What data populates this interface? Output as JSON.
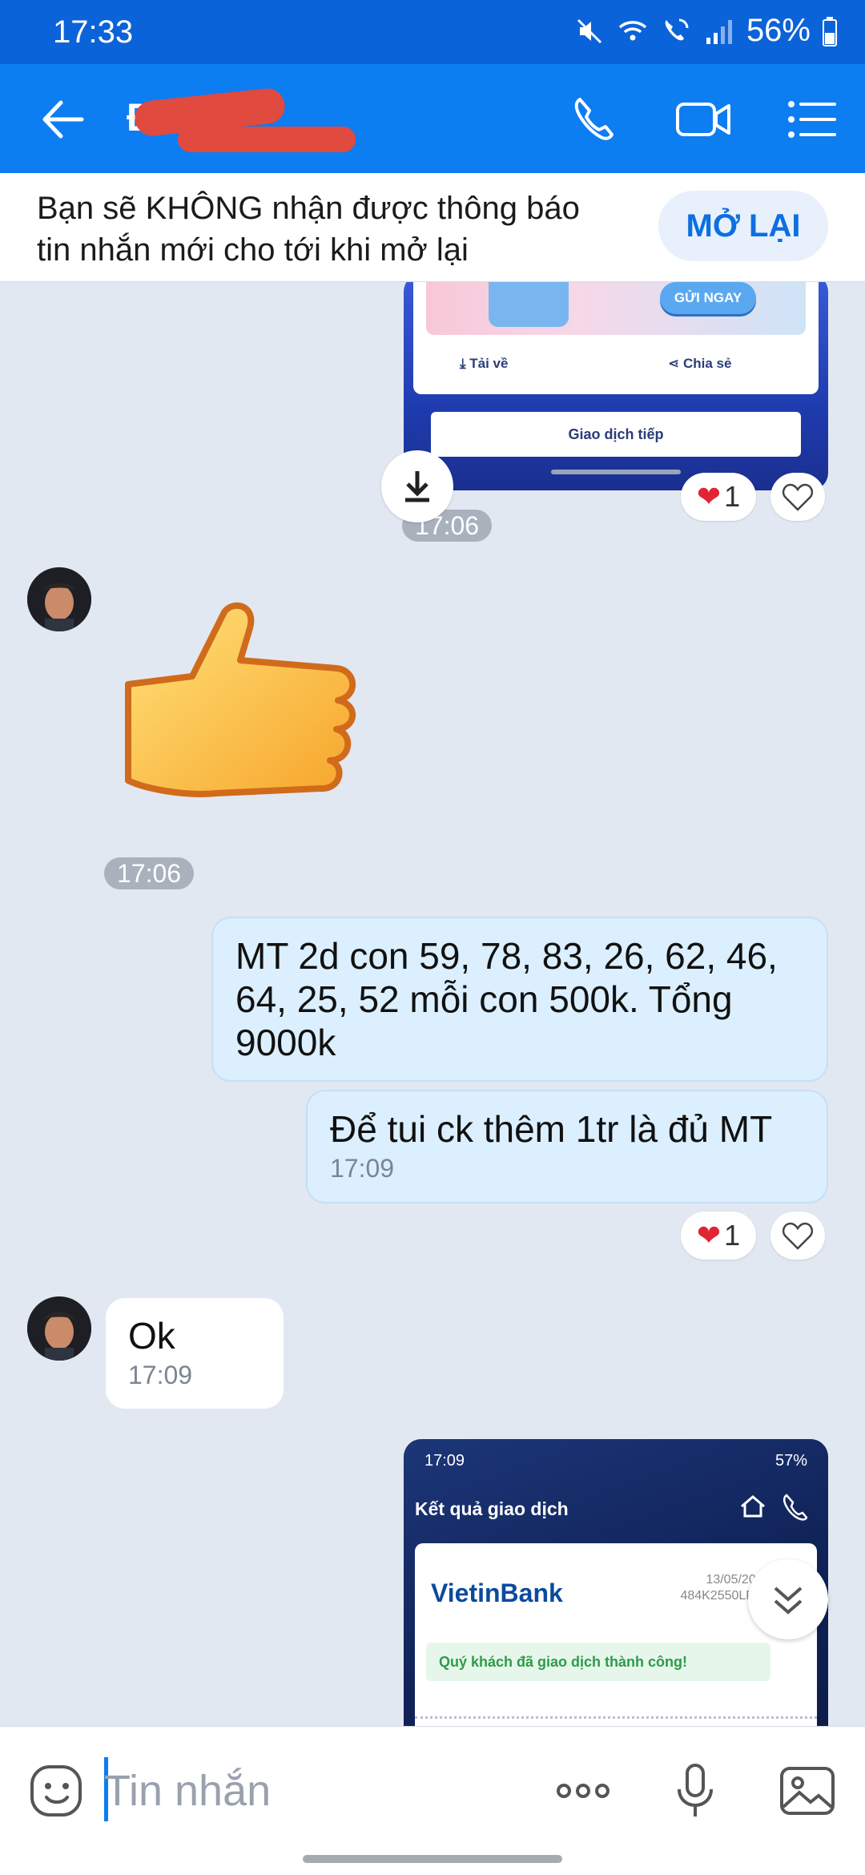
{
  "status_bar": {
    "time": "17:33",
    "battery": "56%"
  },
  "header": {
    "contact_name": "Đ"
  },
  "notice": {
    "text_line1": "Bạn sẽ KHÔNG nhận được thông báo",
    "text_line2": "tin nhắn mới cho tới khi mở lại",
    "button": "MỞ LẠI"
  },
  "promo_card": {
    "send_now": "GỬI NGAY",
    "download": "Tải về",
    "share": "Chia sẻ",
    "continue": "Giao dịch tiếp",
    "reaction_count": "1"
  },
  "messages": {
    "time_1": "17:06",
    "time_2": "17:06",
    "out_1": "MT 2d con 59, 78, 83, 26, 62, 46, 64, 25, 52 mỗi con 500k. Tổng 9000k",
    "out_2": "Để tui ck thêm 1tr là đủ MT",
    "out_2_time": "17:09",
    "out_2_reaction_count": "1",
    "in_1": "Ok",
    "in_1_time": "17:09"
  },
  "receipt_card": {
    "status_time": "17:09",
    "status_battery": "57%",
    "title": "Kết quả giao dịch",
    "bank": "VietinBank",
    "date": "13/05/2025 17:09",
    "ref": "484K2550LEUK4KVN",
    "success": "Quý khách đã giao dịch thành công!"
  },
  "composer": {
    "placeholder": "Tin nhắn"
  },
  "colors": {
    "header": "#0d7df2",
    "status_bar": "#0b63d9",
    "chat_bg": "#e2e8f1",
    "out_bubble": "#dbefff",
    "accent": "#0d6fe0"
  }
}
